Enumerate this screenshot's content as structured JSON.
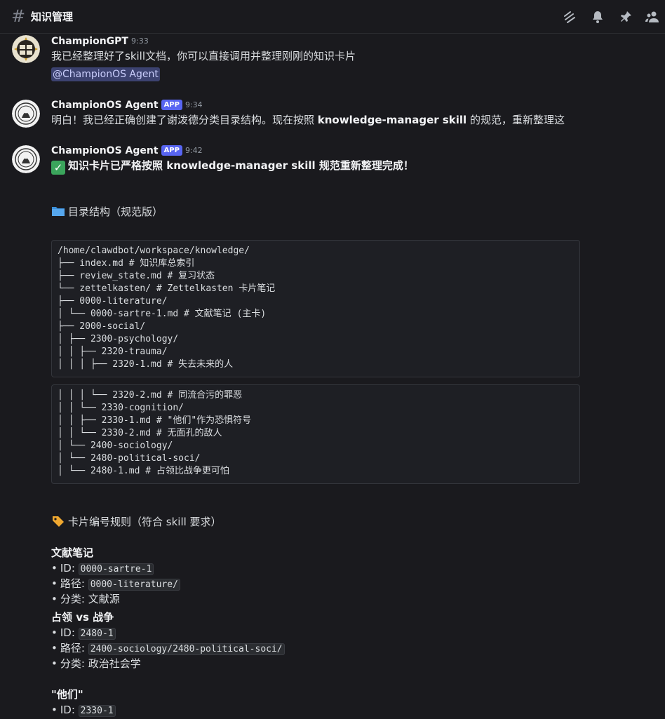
{
  "channel": {
    "hash": "#",
    "title": "知识管理"
  },
  "messages": [
    {
      "author": "ChampionGPT",
      "time": "9:33",
      "text": "我已经整理好了skill文档，你可以直接调用并整理刚刚的知识卡片",
      "mention": "@ChampionOS Agent"
    },
    {
      "author": "ChampionOS Agent",
      "badge": "APP",
      "time": "9:34",
      "text_pre": "明白！我已经正确创建了谢泼德分类目录结构。现在按照 ",
      "text_bold": "knowledge-manager skill",
      "text_post": " 的规范，重新整理这"
    },
    {
      "author": "ChampionOS Agent",
      "badge": "APP",
      "time": "9:42",
      "headline": "知识卡片已严格按照 knowledge-manager skill 规范重新整理完成！",
      "dir_heading": "目录结构（规范版）",
      "code_block_1": [
        "/home/clawdbot/workspace/knowledge/",
        "├── index.md # 知识库总索引",
        "├── review_state.md # 复习状态",
        "└── zettelkasten/ # Zettelkasten 卡片笔记",
        "├── 0000-literature/",
        "│ └── 0000-sartre-1.md # 文献笔记 (主卡)",
        "├── 2000-social/",
        "│ ├── 2300-psychology/",
        "│ │ ├── 2320-trauma/",
        "│ │ │ ├── 2320-1.md # 失去未来的人"
      ],
      "code_block_2": [
        "│ │ │ └── 2320-2.md # 同流合污的罪恶",
        "│ │ └── 2330-cognition/",
        "│ │ ├── 2330-1.md # \"他们\"作为恐惧符号",
        "│ │ └── 2330-2.md # 无面孔的敌人",
        "│ └── 2400-sociology/",
        "│ └── 2480-political-soci/",
        "│ └── 2480-1.md # 占领比战争更可怕"
      ],
      "rules_heading": "卡片编号规则（符合 skill 要求）",
      "cards": [
        {
          "title": "文献笔记",
          "id_label": "ID: ",
          "id": "0000-sartre-1",
          "path_label": "路径: ",
          "path": "0000-literature/",
          "cat_label": "分类: ",
          "category": "文献源"
        },
        {
          "title": "占领 vs 战争",
          "id_label": "ID: ",
          "id": "2480-1",
          "path_label": "路径: ",
          "path": "2400-sociology/2480-political-soci/",
          "cat_label": "分类: ",
          "category": "政治社会学"
        },
        {
          "title": "\"他们\"",
          "id_label": "ID: ",
          "id": "2330-1"
        }
      ]
    }
  ],
  "icons": {
    "threads": "threads-icon",
    "bell": "bell-icon",
    "pin": "pin-icon",
    "members": "members-icon",
    "check": "check-mark-icon",
    "folder": "folder-icon",
    "tag": "tag-icon"
  },
  "colors": {
    "background": "#1a1a1e",
    "accent": "#5865f2",
    "check": "#3ba55c",
    "mention_bg": "#3c4270"
  }
}
